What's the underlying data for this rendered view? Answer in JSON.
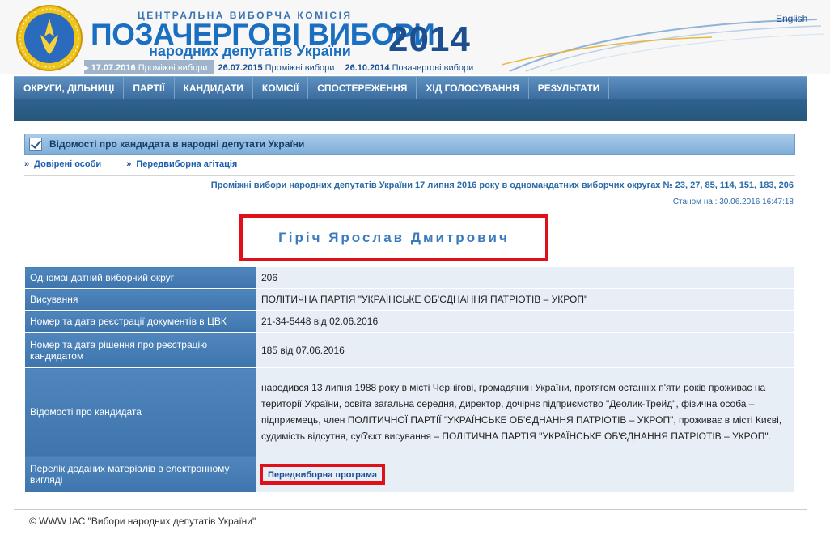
{
  "header": {
    "cvk": "ЦЕНТРАЛЬНА ВИБОРЧА КОМІСІЯ",
    "title": "ПОЗАЧЕРГОВІ ВИБОРИ",
    "subtitle": "народних депутатів України",
    "year": "2014",
    "english_link": "English",
    "elections": [
      {
        "date": "17.07.2016",
        "type": "Проміжні вибори"
      },
      {
        "date": "26.07.2015",
        "type": "Проміжні вибори"
      },
      {
        "date": "26.10.2014",
        "type": "Позачергові вибори"
      }
    ]
  },
  "nav": {
    "items": [
      "ОКРУГИ, ДІЛЬНИЦІ",
      "ПАРТІЇ",
      "КАНДИДАТИ",
      "КОМІСІЇ",
      "СПОСТЕРЕЖЕННЯ",
      "ХІД ГОЛОСУВАННЯ",
      "РЕЗУЛЬТАТИ"
    ]
  },
  "section": {
    "title": "Відомості про кандидата в народні депутати України"
  },
  "links": [
    "Довірені особи",
    "Передвиборна агітація"
  ],
  "election_info": "Проміжні вибори народних депутатів України 17 липня 2016 року в одномандатних виборчих округах № 23, 27, 85, 114, 151, 183, 206",
  "as_of": "Станом на : 30.06.2016 16:47:18",
  "candidate": {
    "name": "Гіріч Ярослав Дмитрович",
    "rows": [
      {
        "label": "Одномандатний виборчий округ",
        "value": "206"
      },
      {
        "label": "Висування",
        "value": "ПОЛІТИЧНА ПАРТІЯ \"УКРАЇНСЬКЕ ОБ'ЄДНАННЯ ПАТРІОТІВ – УКРОП\""
      },
      {
        "label": "Номер та дата реєстрації документів в ЦВК",
        "value": "21-34-5448 від 02.06.2016"
      },
      {
        "label": "Номер та дата рішення про реєстрацію кандидатом",
        "value": "185 від 07.06.2016"
      },
      {
        "label": "Відомості про кандидата",
        "value": "народився 13 липня 1988 року в місті Чернігові, громадянин України, протягом останніх п'яти років проживає на території України, освіта загальна середня, директор, дочірнє підприємство \"Деолик-Трейд\", фізична особа – підприємець, член ПОЛІТИЧНОЇ ПАРТІЇ \"УКРАЇНСЬКЕ ОБ'ЄДНАННЯ ПАТРІОТІВ – УКРОП\", проживає в місті Києві, судимість відсутня, суб'єкт висування – ПОЛІТИЧНА ПАРТІЯ \"УКРАЇНСЬКЕ ОБ'ЄДНАННЯ ПАТРІОТІВ – УКРОП\"."
      },
      {
        "label": "Перелік доданих матеріалів в електронному вигляді",
        "value": "Передвиборна програма"
      }
    ]
  },
  "footer": "© WWW ІАС \"Вибори народних депутатів України\""
}
